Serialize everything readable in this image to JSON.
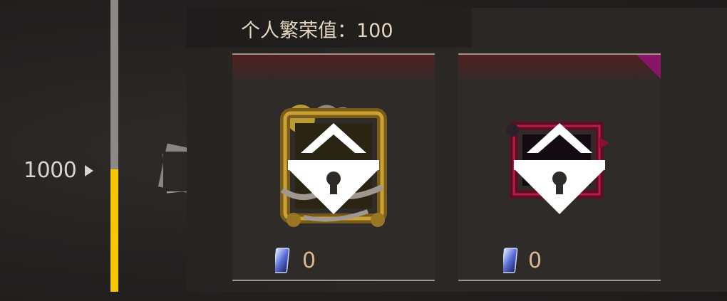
{
  "progress": {
    "milestone_label": "1000",
    "fill_fraction": 0.42
  },
  "header": {
    "prosperity_text": "个人繁荣值：100"
  },
  "rewards": [
    {
      "name": "gold-frame-reward",
      "locked": true,
      "cost_icon": "crystal-card-icon",
      "cost_value": "0"
    },
    {
      "name": "crimson-frame-reward",
      "locked": true,
      "cost_icon": "crystal-card-icon",
      "cost_value": "0"
    }
  ],
  "colors": {
    "progress_fill": "#f7c600",
    "cost_text": "#d9b98c",
    "gold_frame": "#b8912a",
    "crimson_frame": "#7a1030"
  }
}
